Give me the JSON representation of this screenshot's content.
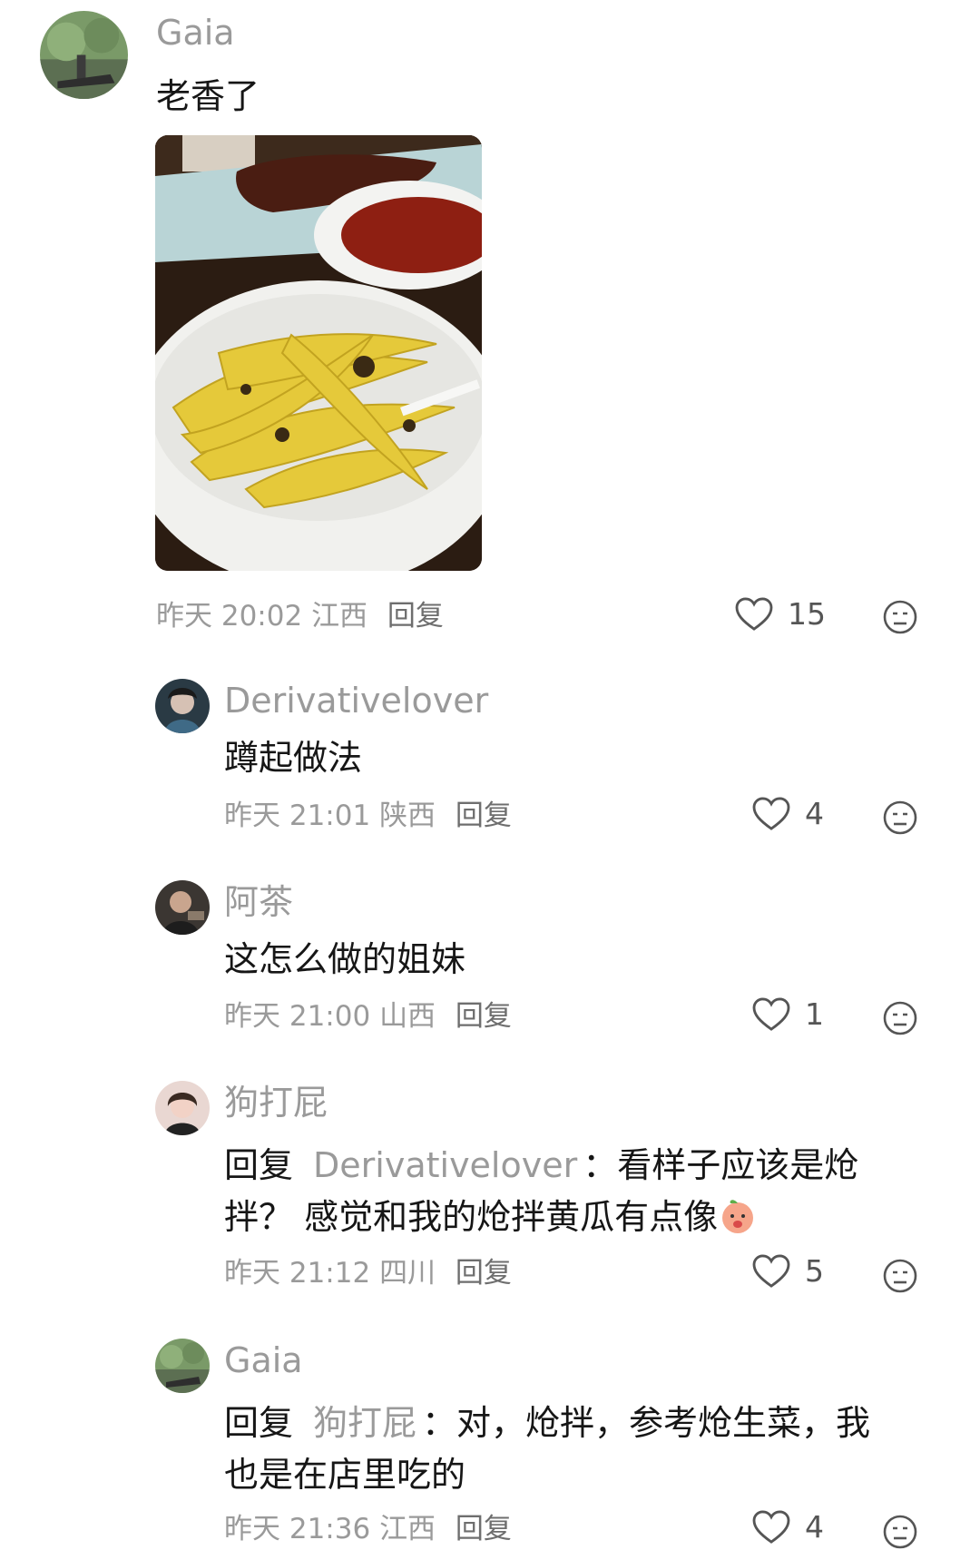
{
  "comment": {
    "author": "Gaia",
    "text": "老香了",
    "time": "昨天 20:02",
    "location": "江西",
    "reply_label": "回复",
    "likes": "15"
  },
  "replies": [
    {
      "author": "Derivativelover",
      "text": "蹲起做法",
      "time": "昨天 21:01",
      "location": "陕西",
      "reply_label": "回复",
      "likes": "4"
    },
    {
      "author": "阿茶",
      "text": "这怎么做的姐妹",
      "time": "昨天 21:00",
      "location": "山西",
      "reply_label": "回复",
      "likes": "1"
    },
    {
      "author": "狗打屁",
      "prefix": "回复",
      "target": "Derivativelover",
      "text_line1": "看样子应该是炝",
      "text_line2": "拌？ 感觉和我的炝拌黄瓜有点像",
      "time": "昨天 21:12",
      "location": "四川",
      "reply_label": "回复",
      "likes": "5"
    },
    {
      "author": "Gaia",
      "prefix": "回复",
      "target": "狗打屁",
      "text_line1": "对，炝拌，参考炝生菜，我",
      "text_line2": "也是在店里吃的",
      "time": "昨天 21:36",
      "location": "江西",
      "reply_label": "回复",
      "likes": "4"
    }
  ],
  "colors": {
    "meta_gray": "#9a9a9a",
    "text": "#161616",
    "background": "#ffffff"
  },
  "icons": {
    "like": "heart-outline-icon",
    "dislike": "neutral-face-icon",
    "sticker": "peach-emoji-icon"
  }
}
